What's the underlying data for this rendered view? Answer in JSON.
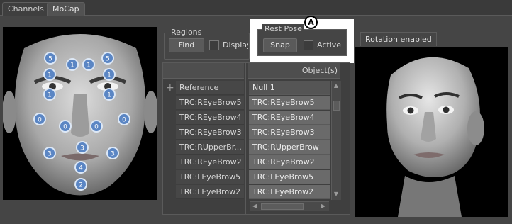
{
  "tabs": [
    {
      "label": "Channels",
      "active": false
    },
    {
      "label": "MoCap",
      "active": true
    }
  ],
  "regions": {
    "title": "Regions",
    "find_label": "Find",
    "display_label": "Display"
  },
  "rest_pose": {
    "title": "Rest Pose",
    "snap_label": "Snap",
    "active_label": "Active",
    "callout_letter": "A"
  },
  "preview": {
    "rotation_label": "Rotation enabled"
  },
  "table": {
    "left_header": "",
    "right_header": "Object(s)",
    "rows": [
      {
        "left": "Reference",
        "right": "Null 1",
        "expandable": true
      },
      {
        "left": "TRC:REyeBrow5",
        "right": "TRC:REyeBrow5"
      },
      {
        "left": "TRC:REyeBrow4",
        "right": "TRC:REyeBrow4"
      },
      {
        "left": "TRC:REyeBrow3",
        "right": "TRC:REyeBrow3"
      },
      {
        "left": "TRC:RUpperBr...",
        "right": "TRC:RUpperBrow"
      },
      {
        "left": "TRC:REyeBrow2",
        "right": "TRC:REyeBrow2"
      },
      {
        "left": "TRC:LEyeBrow5",
        "right": "TRC:LEyeBrow5"
      },
      {
        "left": "TRC:LEyeBrow2",
        "right": "TRC:LEyeBrow2"
      }
    ]
  },
  "markers": [
    {
      "label": "5"
    },
    {
      "label": "1"
    },
    {
      "label": "1"
    },
    {
      "label": "5"
    },
    {
      "label": "1"
    },
    {
      "label": "1"
    },
    {
      "label": "1"
    },
    {
      "label": "1"
    },
    {
      "label": "0"
    },
    {
      "label": "0"
    },
    {
      "label": "0"
    },
    {
      "label": "0"
    },
    {
      "label": "3"
    },
    {
      "label": "3"
    },
    {
      "label": "3"
    },
    {
      "label": "4"
    },
    {
      "label": "2"
    }
  ],
  "colors": {
    "background": "#454545",
    "marker_fill": "#5b86c4",
    "marker_ring": "#dde8f6",
    "callout": "#ffffff"
  }
}
